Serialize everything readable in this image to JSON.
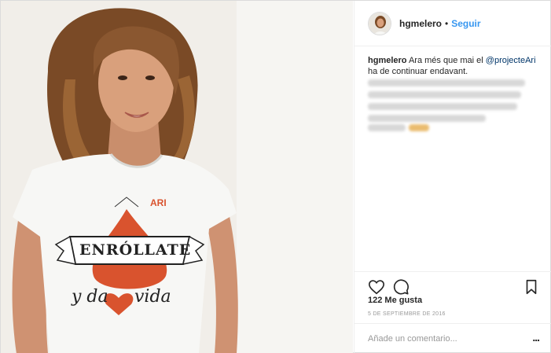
{
  "post": {
    "username": "hgmelero",
    "follow_separator": "•",
    "follow_label": "Seguir",
    "caption": {
      "user": "hgmelero",
      "text_before": "Ara més que mai el ",
      "mention": "@projecteAri",
      "text_after": " ha de continuar endavant."
    },
    "likes_label": "122 Me gusta",
    "date": "5 DE SEPTIEMBRE DE 2016",
    "comment_placeholder": "Añade un comentario...",
    "more_label": "..."
  },
  "photo": {
    "tshirt_brand": "ARI",
    "tshirt_banner": "ENRÓLLATE",
    "tshirt_script_1": "y da",
    "tshirt_script_2": "vida"
  },
  "icons": {
    "like": "heart-icon",
    "comment": "comment-icon",
    "save": "bookmark-icon",
    "more": "more-options-icon"
  },
  "colors": {
    "link_blue": "#3897f0",
    "mention_blue": "#003569",
    "text": "#262626",
    "muted": "#999999",
    "border": "#efefef",
    "tshirt_red": "#d9532e"
  }
}
